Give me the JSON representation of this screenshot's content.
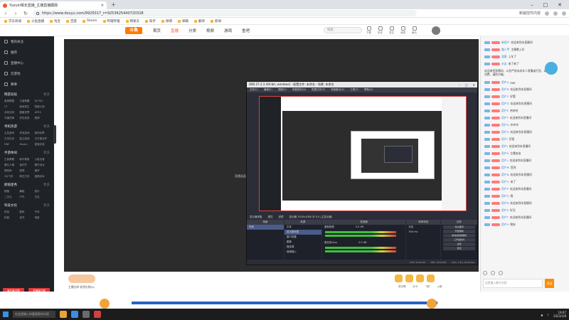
{
  "browser": {
    "tab_title": "Yuzuki晴长直播_主播直播跟踪",
    "new_tab": "+",
    "minimize": "–",
    "maximize": "□",
    "close": "✕",
    "back": "‹",
    "forward": "›",
    "reload": "↻",
    "url": "https://www.douyu.com/9925017_r=9253625440720328",
    "right_text": "新版控件内容"
  },
  "bookmarks": [
    "京东商城",
    "斗鱼直播",
    "淘宝",
    "百度",
    "Steam",
    "哔哩哔哩",
    "网易云",
    "知乎",
    "微博",
    "邮箱",
    "翻译",
    "新闻"
  ],
  "site": {
    "logo": "斗鱼",
    "nav": [
      "首页",
      "直播",
      "分类",
      "视频",
      "游戏",
      "鱼吧"
    ],
    "active_nav": "直播",
    "search_placeholder": "搜索",
    "header_icons": [
      "下载",
      "历史",
      "关注",
      "消息",
      "鱼丸"
    ]
  },
  "sidebar": {
    "top_items": [
      "我的关注",
      "推荐",
      "直播中心",
      "云游戏",
      "赛事"
    ],
    "sections": [
      {
        "title": "网游竞技",
        "more": "更多",
        "items": [
          "英雄联盟",
          "王者荣耀",
          "DOTA2",
          "CF",
          "绝地求生",
          "穿越火线",
          "永劫无间",
          "魔兽世界",
          "APEX",
          "守望先锋",
          "炉石传说",
          "原神"
        ]
      },
      {
        "title": "单机热游",
        "more": "更多",
        "items": [
          "主机游戏",
          "怀旧游戏",
          "我的世界",
          "方舟生存",
          "独立游戏",
          "艾尔登法环",
          "DNF",
          "Steam",
          "部落冲突"
        ]
      },
      {
        "title": "手游休闲",
        "more": "更多",
        "items": [
          "王者荣耀",
          "和平精英",
          "火影忍者",
          "第五人格",
          "金铲铲",
          "蛋仔派对",
          "阴阳师",
          "原神",
          "崩坏",
          "QQ飞车",
          "明日方舟",
          "香肠派对"
        ]
      },
      {
        "title": "颜值星秀",
        "more": "更多",
        "items": [
          "颜值",
          "舞蹈",
          "音乐",
          "二次元",
          "户外",
          "交友"
        ]
      },
      {
        "title": "科技文化",
        "more": "更多",
        "items": [
          "科技",
          "数码",
          "汽车",
          "科普",
          "读书",
          "电影"
        ]
      }
    ],
    "btn_left": "客户端下载",
    "btn_right": "开播客户端"
  },
  "player": {
    "label": "直播画面"
  },
  "obs": {
    "title": "OBS 27.2.3 (64-bit, windows) - 配置文件: 未命名 - 场景: 未命名",
    "menu": [
      "文件(F)",
      "编辑(E)",
      "视图(V)",
      "停靠部件(D)",
      "配置文件(P)",
      "场景集合(S)",
      "工具(T)",
      "帮助(H)"
    ],
    "stream_bar": [
      "显示器采集",
      "属性",
      "滤镜",
      "显示器 1920x1080 @ 0,0 (主显示器)"
    ],
    "docks": {
      "scenes": {
        "title": "场景",
        "items": [
          "场景"
        ]
      },
      "sources": {
        "title": "来源",
        "items": [
          "文本",
          "显示器采集",
          "窗口采集",
          "图像",
          "媒体源",
          "音频输入"
        ]
      },
      "mixer": {
        "title": "混音器",
        "tracks": [
          "桌面音频",
          "麦克风/Aux"
        ],
        "levels": [
          "0.0 dB",
          "0.0 dB"
        ]
      },
      "transitions": {
        "title": "转场特效",
        "fade": "淡出",
        "duration": "300 ms"
      },
      "controls": {
        "title": "控件",
        "buttons": [
          "停止推流",
          "开始录制",
          "启动虚拟摄像机",
          "工作室模式",
          "设置",
          "退出"
        ]
      }
    },
    "status": [
      "LIVE: 00:00:00",
      "REC: 00:00:00",
      "CPU: 1.4%, 60.00 fps"
    ]
  },
  "chat": {
    "notice": "欢迎来到直播间，斗鱼严禁未成年人直播或打赏，请理性消费，谨防诈骗。",
    "messages": [
      {
        "nick": "新用户",
        "text": "欢迎来到本直播间"
      },
      {
        "nick": "路人甲",
        "text": "主播晚上好"
      },
      {
        "nick": "游客",
        "text": "上车了"
      },
      {
        "nick": "水友",
        "text": "来了来了"
      },
      {
        "nick": "用户A",
        "text": "666"
      },
      {
        "nick": "用户B",
        "text": "欢迎来到本直播间"
      },
      {
        "nick": "用户C",
        "text": "好看"
      },
      {
        "nick": "用户D",
        "text": "欢迎来到本直播间"
      },
      {
        "nick": "用户E",
        "text": "哈哈哈"
      },
      {
        "nick": "用户F",
        "text": "欢迎来到本直播间"
      },
      {
        "nick": "用户G",
        "text": "冲冲冲"
      },
      {
        "nick": "用户H",
        "text": "欢迎来到本直播间"
      },
      {
        "nick": "用户I",
        "text": "厉害"
      },
      {
        "nick": "用户J",
        "text": "欢迎来到本直播间"
      },
      {
        "nick": "用户K",
        "text": "主播加油"
      },
      {
        "nick": "用户L",
        "text": "欢迎来到本直播间"
      },
      {
        "nick": "用户M",
        "text": "签到"
      },
      {
        "nick": "用户N",
        "text": "欢迎来到本直播间"
      },
      {
        "nick": "用户O",
        "text": "来了"
      },
      {
        "nick": "用户P",
        "text": "欢迎来到本直播间"
      },
      {
        "nick": "用户Q",
        "text": "稳"
      },
      {
        "nick": "用户R",
        "text": "欢迎来到本直播间"
      },
      {
        "nick": "用户S",
        "text": "好活"
      },
      {
        "nick": "用户T",
        "text": "欢迎来到本直播间"
      },
      {
        "nick": "用户U",
        "text": "晚安"
      }
    ],
    "input_placeholder": "这里输入聊天内容",
    "send_label": "发送"
  },
  "giftbar": {
    "text": "主播仓库 收到礼物(0)",
    "gift_labels": [
      "荧光棒",
      "办卡",
      "飞机",
      "火箭"
    ]
  },
  "taskbar": {
    "search_placeholder": "在这里输入你要搜索的内容",
    "time": "19:07",
    "date": "2023/2/8"
  },
  "colors": {
    "brand": "#ff5d23",
    "sidebar_bg": "#1f2227",
    "obs_bg": "#2b2e38",
    "taskbar_bg": "#1c1c1c"
  }
}
